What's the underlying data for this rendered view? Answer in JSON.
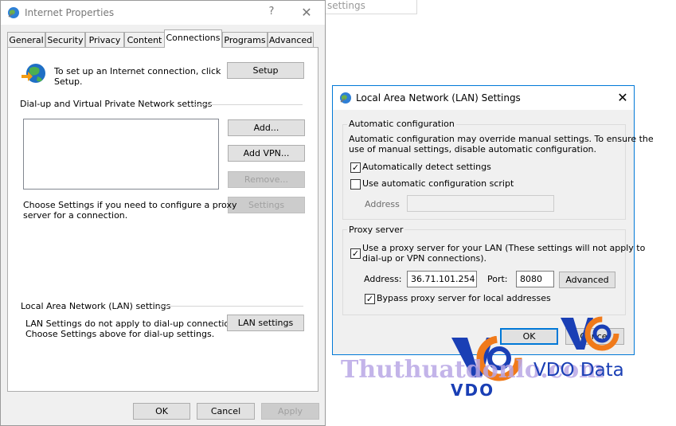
{
  "background": {
    "search_placeholder": "settings"
  },
  "internet_properties": {
    "title": "Internet Properties",
    "help": "?",
    "close": "✕",
    "tabs": [
      "General",
      "Security",
      "Privacy",
      "Content",
      "Connections",
      "Programs",
      "Advanced"
    ],
    "active_tab": "Connections",
    "setup_text_line1": "To set up an Internet connection, click",
    "setup_text_line2": "Setup.",
    "setup_button": "Setup",
    "dialup_heading": "Dial-up and Virtual Private Network settings",
    "add_button": "Add...",
    "add_vpn_button": "Add VPN...",
    "remove_button": "Remove...",
    "settings_button": "Settings",
    "proxy_hint_line1": "Choose Settings if you need to configure a proxy",
    "proxy_hint_line2": "server for a connection.",
    "lan_heading": "Local Area Network (LAN) settings",
    "lan_text_line1": "LAN Settings do not apply to dial-up connections.",
    "lan_text_line2": "Choose Settings above for dial-up settings.",
    "lan_settings_button": "LAN settings",
    "ok_button": "OK",
    "cancel_button": "Cancel",
    "apply_button": "Apply"
  },
  "lan_dialog": {
    "title": "Local Area Network (LAN) Settings",
    "close": "✕",
    "auto_group": "Automatic configuration",
    "auto_desc_line1": "Automatic configuration may override manual settings.  To ensure the",
    "auto_desc_line2": "use of manual settings, disable automatic configuration.",
    "auto_detect_label": "Automatically detect settings",
    "auto_detect_checked": true,
    "auto_script_label": "Use automatic configuration script",
    "auto_script_checked": false,
    "address_label": "Address",
    "address_value": "",
    "proxy_group": "Proxy server",
    "use_proxy_line1": "Use a proxy server for your LAN (These settings will not apply to",
    "use_proxy_line2": "dial-up or VPN connections).",
    "use_proxy_checked": true,
    "proxy_address_label": "Address:",
    "proxy_address_value": "36.71.101.254",
    "port_label": "Port:",
    "port_value": "8080",
    "advanced_button": "Advanced",
    "bypass_label": "Bypass proxy server for local addresses",
    "bypass_checked": true,
    "ok_button": "OK",
    "cancel_button": "Cancel"
  },
  "watermark": {
    "site_text": "Thuthuatdonlo.com",
    "logo_text": "VDO",
    "brand_text": "VDO Data",
    "colors": {
      "blue": "#1a3fb5",
      "orange": "#f07a1a",
      "purple": "#b9a8e6"
    }
  }
}
